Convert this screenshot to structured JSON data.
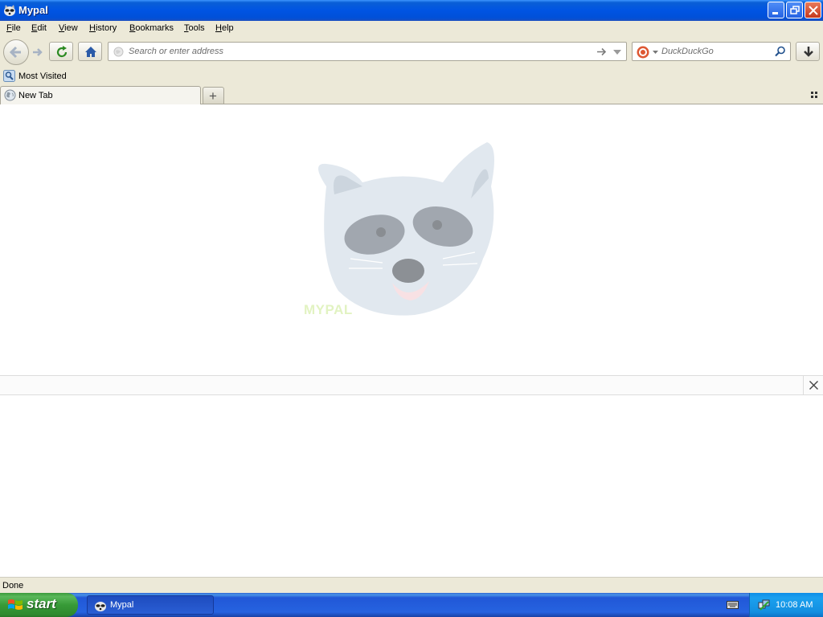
{
  "window": {
    "title": "Mypal",
    "controls": [
      "minimize-icon",
      "restore-icon",
      "close-icon"
    ]
  },
  "menu": {
    "items": [
      {
        "label": "File",
        "accel": "F",
        "rest": "ile"
      },
      {
        "label": "Edit",
        "accel": "E",
        "rest": "dit"
      },
      {
        "label": "View",
        "accel": "V",
        "rest": "iew"
      },
      {
        "label": "History",
        "accel": "H",
        "rest": "istory"
      },
      {
        "label": "Bookmarks",
        "accel": "B",
        "rest": "ookmarks"
      },
      {
        "label": "Tools",
        "accel": "T",
        "rest": "ools"
      },
      {
        "label": "Help",
        "accel": "H",
        "rest": "elp"
      }
    ]
  },
  "navbar": {
    "address_placeholder": "Search or enter address",
    "search_placeholder": "DuckDuckGo",
    "search_engine_icon": "duckduckgo-icon"
  },
  "bookmarks": {
    "items": [
      {
        "label": "Most Visited",
        "icon": "most-visited-icon"
      }
    ]
  },
  "tabs": {
    "items": [
      {
        "label": "New Tab",
        "icon": "globe-icon"
      }
    ]
  },
  "content": {
    "logo_text": "MYPAL"
  },
  "status": {
    "text": "Done"
  },
  "taskbar": {
    "start_label": "start",
    "task_label": "Mypal",
    "clock": "10:08 AM"
  },
  "colors": {
    "titlebar": "#0054e3",
    "taskbar": "#2663e0",
    "start": "#379a37",
    "chrome": "#ece9d8"
  }
}
